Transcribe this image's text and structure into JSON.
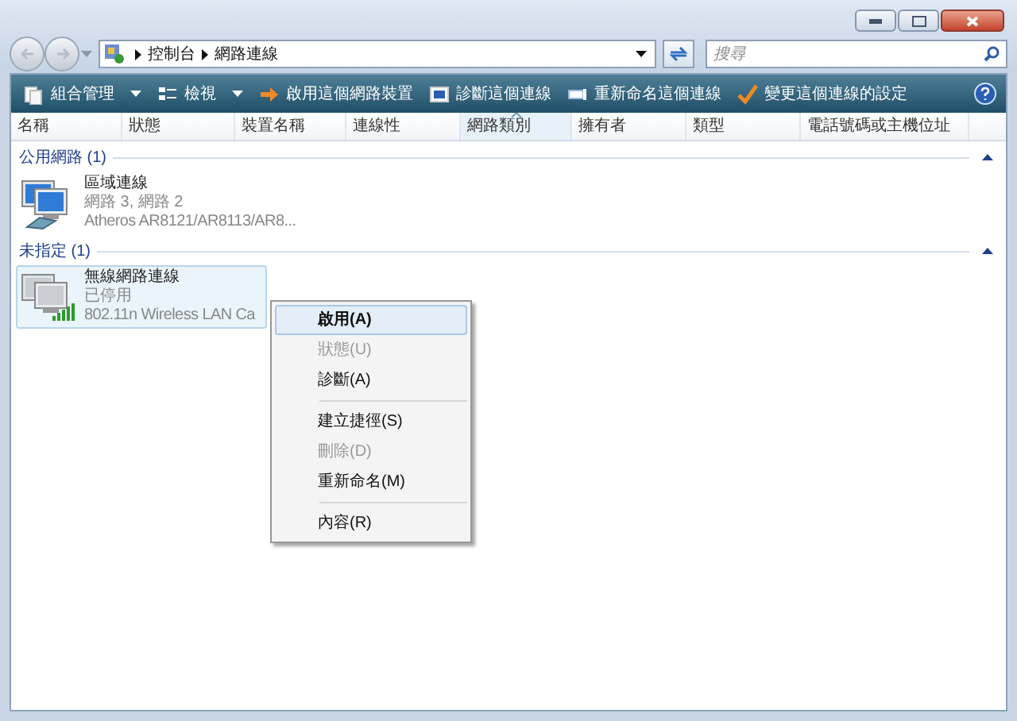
{
  "address_bar": {
    "crumbs": [
      "控制台",
      "網路連線"
    ]
  },
  "search": {
    "placeholder": "搜尋"
  },
  "toolbar": [
    {
      "label": "組合管理",
      "dropdown": true
    },
    {
      "label": "檢視",
      "dropdown": true
    },
    {
      "label": "啟用這個網路裝置",
      "dropdown": false
    },
    {
      "label": "診斷這個連線",
      "dropdown": false
    },
    {
      "label": "重新命名這個連線",
      "dropdown": false
    },
    {
      "label": "變更這個連線的設定",
      "dropdown": false
    }
  ],
  "columns": [
    {
      "label": "名稱",
      "sorted": false
    },
    {
      "label": "狀態",
      "sorted": false
    },
    {
      "label": "裝置名稱",
      "sorted": false
    },
    {
      "label": "連線性",
      "sorted": false
    },
    {
      "label": "網路類別",
      "sorted": true
    },
    {
      "label": "擁有者",
      "sorted": false
    },
    {
      "label": "類型",
      "sorted": false
    },
    {
      "label": "電話號碼或主機位址",
      "sorted": false
    }
  ],
  "groups": [
    {
      "title": "公用網路 (1)",
      "items": [
        {
          "kind": "wired",
          "name": "區域連線",
          "status": "網路 3, 網路 2",
          "device": "Atheros AR8121/AR8113/AR8...",
          "selected": false
        }
      ]
    },
    {
      "title": "未指定 (1)",
      "items": [
        {
          "kind": "wireless",
          "name": "無線網路連線",
          "status": "已停用",
          "device": "802.11n Wireless LAN Ca",
          "selected": true
        }
      ]
    }
  ],
  "context_menu": {
    "sections": [
      [
        {
          "label": "啟用(A)",
          "default": true,
          "disabled": false,
          "selected": true
        },
        {
          "label": "狀態(U)",
          "default": false,
          "disabled": true,
          "selected": false
        },
        {
          "label": "診斷(A)",
          "default": false,
          "disabled": false,
          "selected": false
        }
      ],
      [
        {
          "label": "建立捷徑(S)",
          "default": false,
          "disabled": false,
          "selected": false
        },
        {
          "label": "刪除(D)",
          "default": false,
          "disabled": true,
          "selected": false
        },
        {
          "label": "重新命名(M)",
          "default": false,
          "disabled": false,
          "selected": false
        }
      ],
      [
        {
          "label": "內容(R)",
          "default": false,
          "disabled": false,
          "selected": false
        }
      ]
    ]
  }
}
